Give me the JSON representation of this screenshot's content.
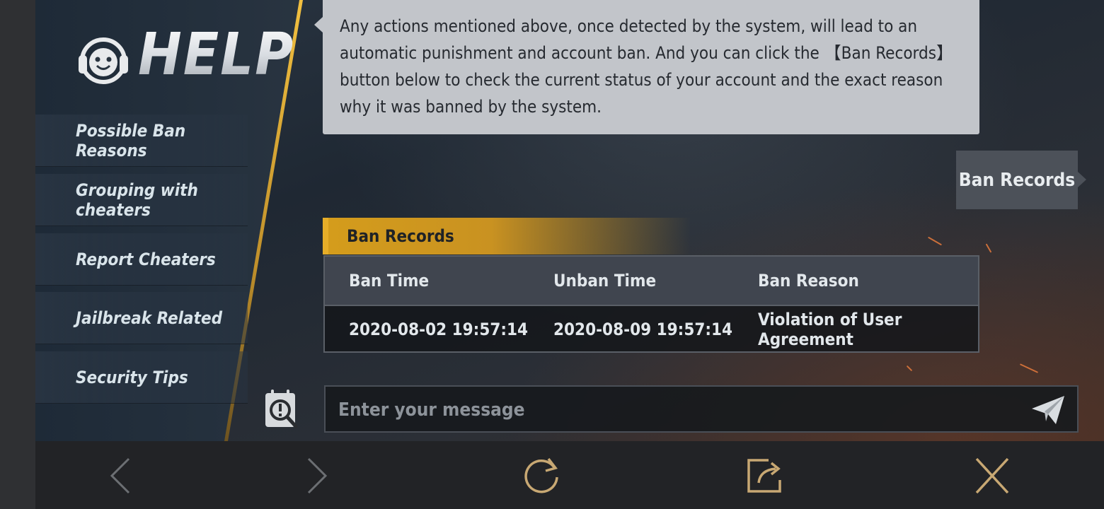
{
  "header": {
    "logo_text": "HELP",
    "icon": "headset-bot-icon"
  },
  "sidebar": {
    "items": [
      {
        "label": "Possible Ban Reasons"
      },
      {
        "label": "Grouping with cheaters"
      },
      {
        "label": "Report Cheaters"
      },
      {
        "label": "Jailbreak Related"
      },
      {
        "label": "Security Tips"
      }
    ]
  },
  "chat": {
    "message": "Any actions mentioned above, once detected by the system, will lead to an automatic punishment and account ban. And you can click the 【Ban Records】 button below to check the current status of your account and the exact reason why it was banned by the system.",
    "ban_records_button": "Ban Records"
  },
  "records": {
    "title": "Ban Records",
    "columns": [
      "Ban Time",
      "Unban Time",
      "Ban Reason"
    ],
    "rows": [
      [
        "2020-08-02 19:57:14",
        "2020-08-09 19:57:14",
        "Violation of User Agreement"
      ]
    ]
  },
  "input": {
    "placeholder": "Enter your message"
  },
  "colors": {
    "accent_gold": "#d49c1c",
    "bubble": "#c2c5ca"
  },
  "bottom_bar": {
    "icons": [
      "back-icon",
      "forward-icon",
      "refresh-icon",
      "share-icon",
      "close-icon"
    ]
  }
}
